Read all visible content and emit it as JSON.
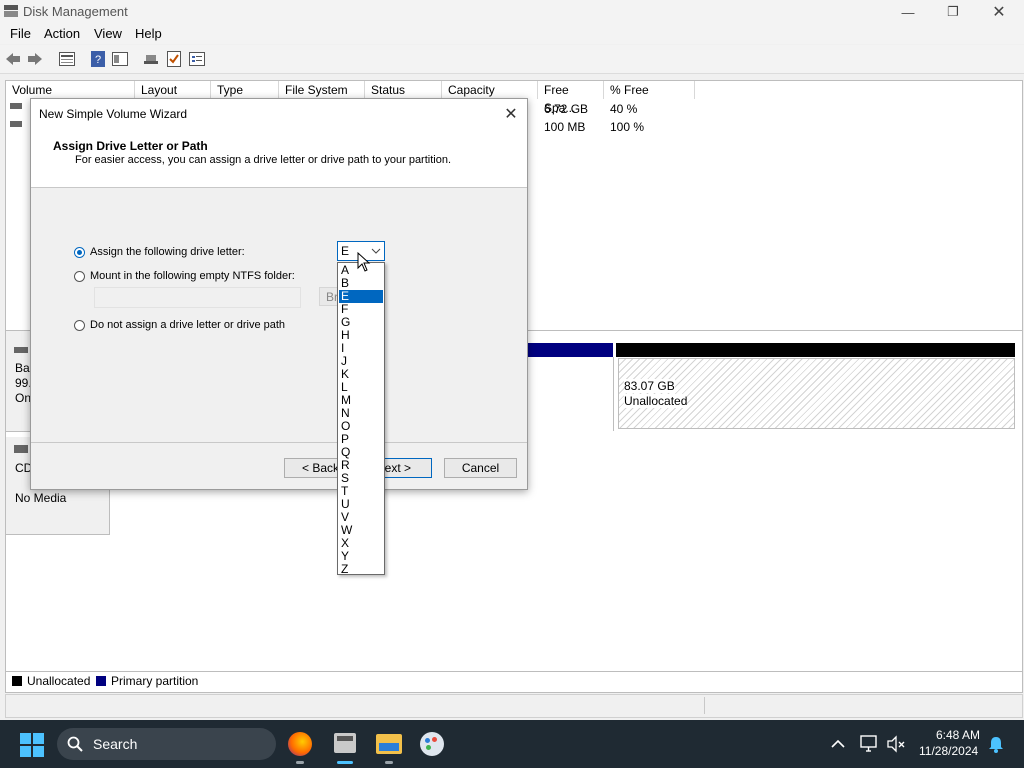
{
  "window": {
    "title": "Disk Management"
  },
  "menu": [
    "File",
    "Action",
    "View",
    "Help"
  ],
  "volume_table": {
    "columns": [
      "Volume",
      "Layout",
      "Type",
      "File System",
      "Status",
      "Capacity",
      "Free Spa...",
      "% Free"
    ],
    "rows": [
      {
        "free": "6.72 GB",
        "pct": "40 %"
      },
      {
        "free": "100 MB",
        "pct": "100 %"
      }
    ]
  },
  "disk0": {
    "label_lines": [
      "Bas",
      "99.",
      "On"
    ],
    "unalloc_size": "83.07 GB",
    "unalloc_label": "Unallocated"
  },
  "cdrom": {
    "label": "CD",
    "media": "No Media"
  },
  "legend": {
    "unallocated": "Unallocated",
    "primary": "Primary partition",
    "unallocated_color": "#000000",
    "primary_color": "#000080"
  },
  "wizard": {
    "title": "New Simple Volume Wizard",
    "heading": "Assign Drive Letter or Path",
    "subheading": "For easier access, you can assign a drive letter or drive path to your partition.",
    "option_assign": "Assign the following drive letter:",
    "option_mount": "Mount in the following empty NTFS folder:",
    "option_none": "Do not assign a drive letter or drive path",
    "browse_label": "Br",
    "back_label": "< Back",
    "next_label": "ext >",
    "cancel_label": "Cancel"
  },
  "dropdown": {
    "selected": "E",
    "options": [
      "A",
      "B",
      "E",
      "F",
      "G",
      "H",
      "I",
      "J",
      "K",
      "L",
      "M",
      "N",
      "O",
      "P",
      "Q",
      "R",
      "S",
      "T",
      "U",
      "V",
      "W",
      "X",
      "Y",
      "Z"
    ],
    "highlighted": "E",
    "accent": "#0067c0"
  },
  "taskbar": {
    "search_label": "Search",
    "time": "6:48 AM",
    "date": "11/28/2024"
  }
}
